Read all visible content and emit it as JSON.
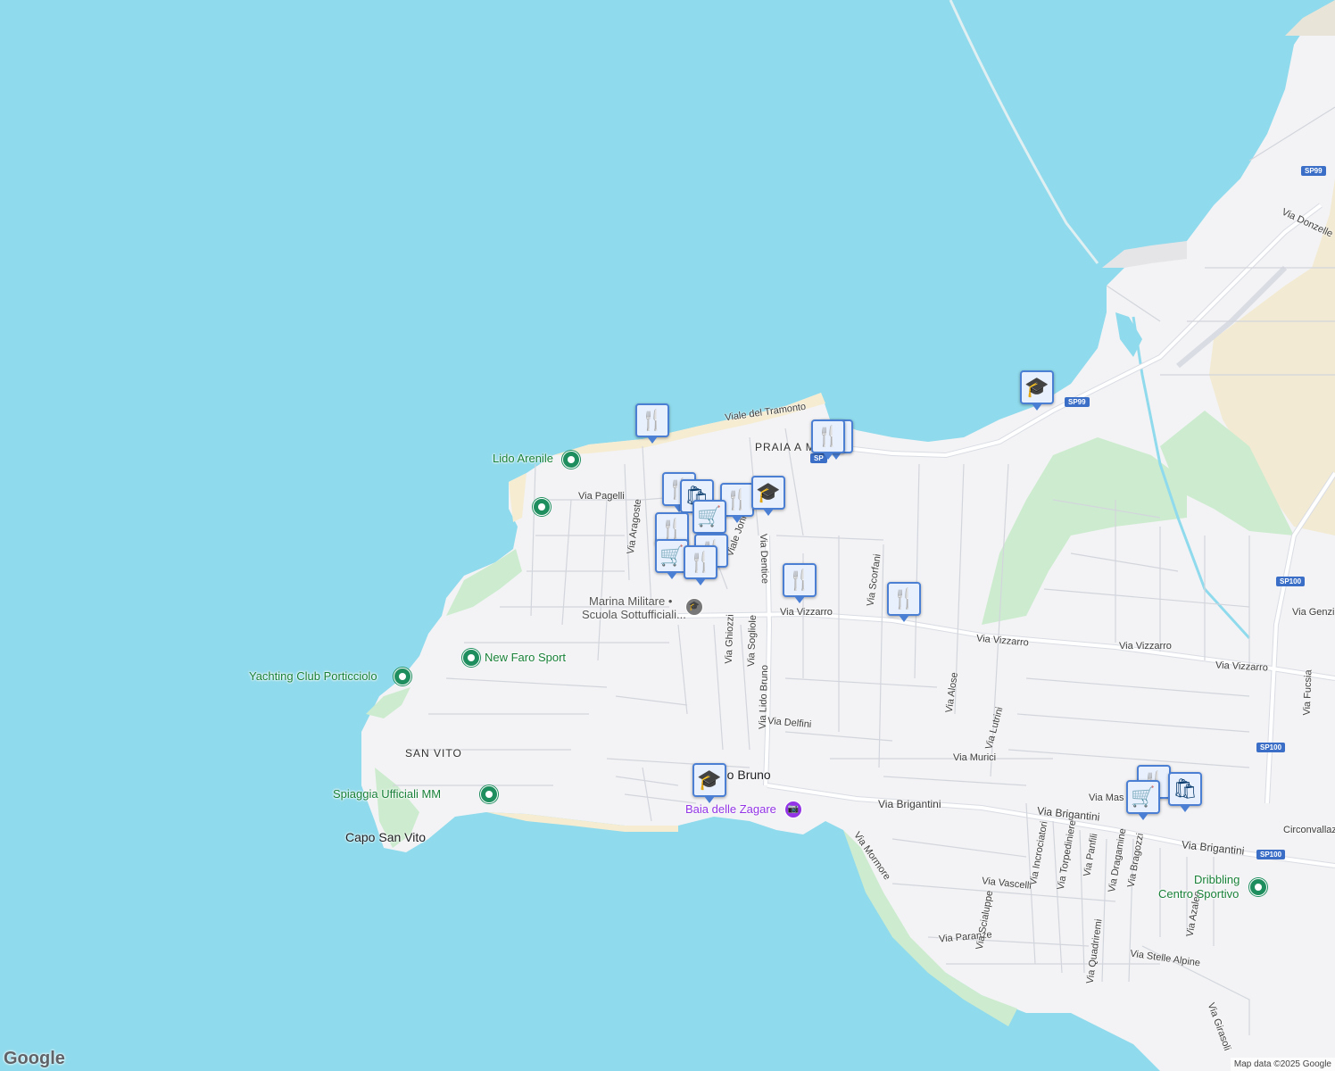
{
  "map": {
    "colors": {
      "water": "#8fdaec",
      "land": "#f3f3f5",
      "park": "#cdeccf",
      "sand": "#f5ecd2",
      "road": "#ffffff",
      "route_shield": "#3b6fc7"
    },
    "place_labels": {
      "san_vito": "SAN VITO",
      "capo_san_vito": "Capo San Vito",
      "lido_bruno": "Lido Bruno",
      "praia_a_mare": "PRAIA A MA"
    },
    "poi_labels": {
      "lido_arenile": "Lido Arenile",
      "new_faro_sport": "New Faro Sport",
      "yachting_club": "Yachting Club Porticciolo",
      "spiaggia_ufficiali": "Spiaggia Ufficiali MM",
      "dribbling_line1": "Dribbling",
      "dribbling_line2": "Centro Sportivo",
      "marina_line1": "Marina Militare •",
      "marina_line2": "Scuola Sottufficiali...",
      "baia_zagare": "Baia delle Zagare"
    },
    "streets": {
      "viale_tramonto": "Viale del Tramonto",
      "via_pagelli": "Via Pagelli",
      "via_aragoste": "Via Aragoste",
      "viale_jonio": "Viale Jonio",
      "via_dentice": "Via Dentice",
      "via_vizzarro": "Via Vizzarro",
      "via_scorfani": "Via Scorfani",
      "via_ghiozzi": "Via Ghiozzi",
      "via_sogliole": "Via Sogliole",
      "via_lido_bruno": "Via Lido Bruno",
      "via_delfini": "Via Delfini",
      "via_alose": "Via Alose",
      "via_lutrini": "Via Lutrini",
      "via_murici": "Via Murici",
      "via_brigantini": "Via Brigantini",
      "via_mormore": "Via Mormore",
      "via_vascelli": "Via Vascelli",
      "via_paranze": "Via Paranze",
      "via_scialuppe": "Via Scialuppe",
      "via_incrociatori": "Via Incrociatori",
      "via_torpediniere": "Via Torpediniere",
      "via_panfili": "Via Panfili",
      "via_dragamine": "Via Dragamine",
      "via_bragozzi": "Via Bragozzi",
      "via_quadriremi": "Via Quadriremi",
      "via_azalee": "Via Azalee",
      "via_stelle_alpine": "Via Stelle Alpine",
      "via_girasoli": "Via Girasoli",
      "via_mas": "Via Mas",
      "circonvallazione": "Circonvallaz",
      "via_fucsia": "Via Fucsia",
      "via_genzi": "Via Genzi",
      "via_donzelle": "Via Donzelle"
    },
    "route_shields": {
      "sp99": "SP99",
      "sp100": "SP100",
      "sp_short": "SP"
    },
    "markers": [
      {
        "id": "restaurant-1",
        "icon": "restaurant-icon",
        "glyph": "🍴"
      },
      {
        "id": "restaurant-2",
        "icon": "restaurant-icon",
        "glyph": "🍴"
      },
      {
        "id": "restaurant-3",
        "icon": "restaurant-icon",
        "glyph": "🍴"
      },
      {
        "id": "shopping-bag-1",
        "icon": "shopping-bag-icon",
        "glyph": "🛍"
      },
      {
        "id": "restaurant-4",
        "icon": "restaurant-icon",
        "glyph": "🍴"
      },
      {
        "id": "school-1",
        "icon": "school-icon",
        "glyph": "🎓"
      },
      {
        "id": "cart-1",
        "icon": "shopping-cart-icon",
        "glyph": "🛒"
      },
      {
        "id": "restaurant-5",
        "icon": "restaurant-icon",
        "glyph": "🍴"
      },
      {
        "id": "cart-2",
        "icon": "shopping-cart-icon",
        "glyph": "🛒"
      },
      {
        "id": "restaurant-6",
        "icon": "restaurant-icon",
        "glyph": "🍴"
      },
      {
        "id": "restaurant-7",
        "icon": "restaurant-icon",
        "glyph": "🍴"
      },
      {
        "id": "restaurant-8",
        "icon": "restaurant-icon",
        "glyph": "🍴"
      },
      {
        "id": "school-2",
        "icon": "school-icon",
        "glyph": "🎓"
      },
      {
        "id": "school-3",
        "icon": "school-icon",
        "glyph": "🎓"
      },
      {
        "id": "restaurant-9",
        "icon": "restaurant-icon",
        "glyph": "🍴"
      },
      {
        "id": "shopping-bag-2",
        "icon": "shopping-bag-icon",
        "glyph": "🛍"
      },
      {
        "id": "cart-3",
        "icon": "shopping-cart-icon",
        "glyph": "🛒"
      }
    ],
    "branding": {
      "logo": "Google",
      "attribution": "Map data ©2025 Google"
    }
  }
}
